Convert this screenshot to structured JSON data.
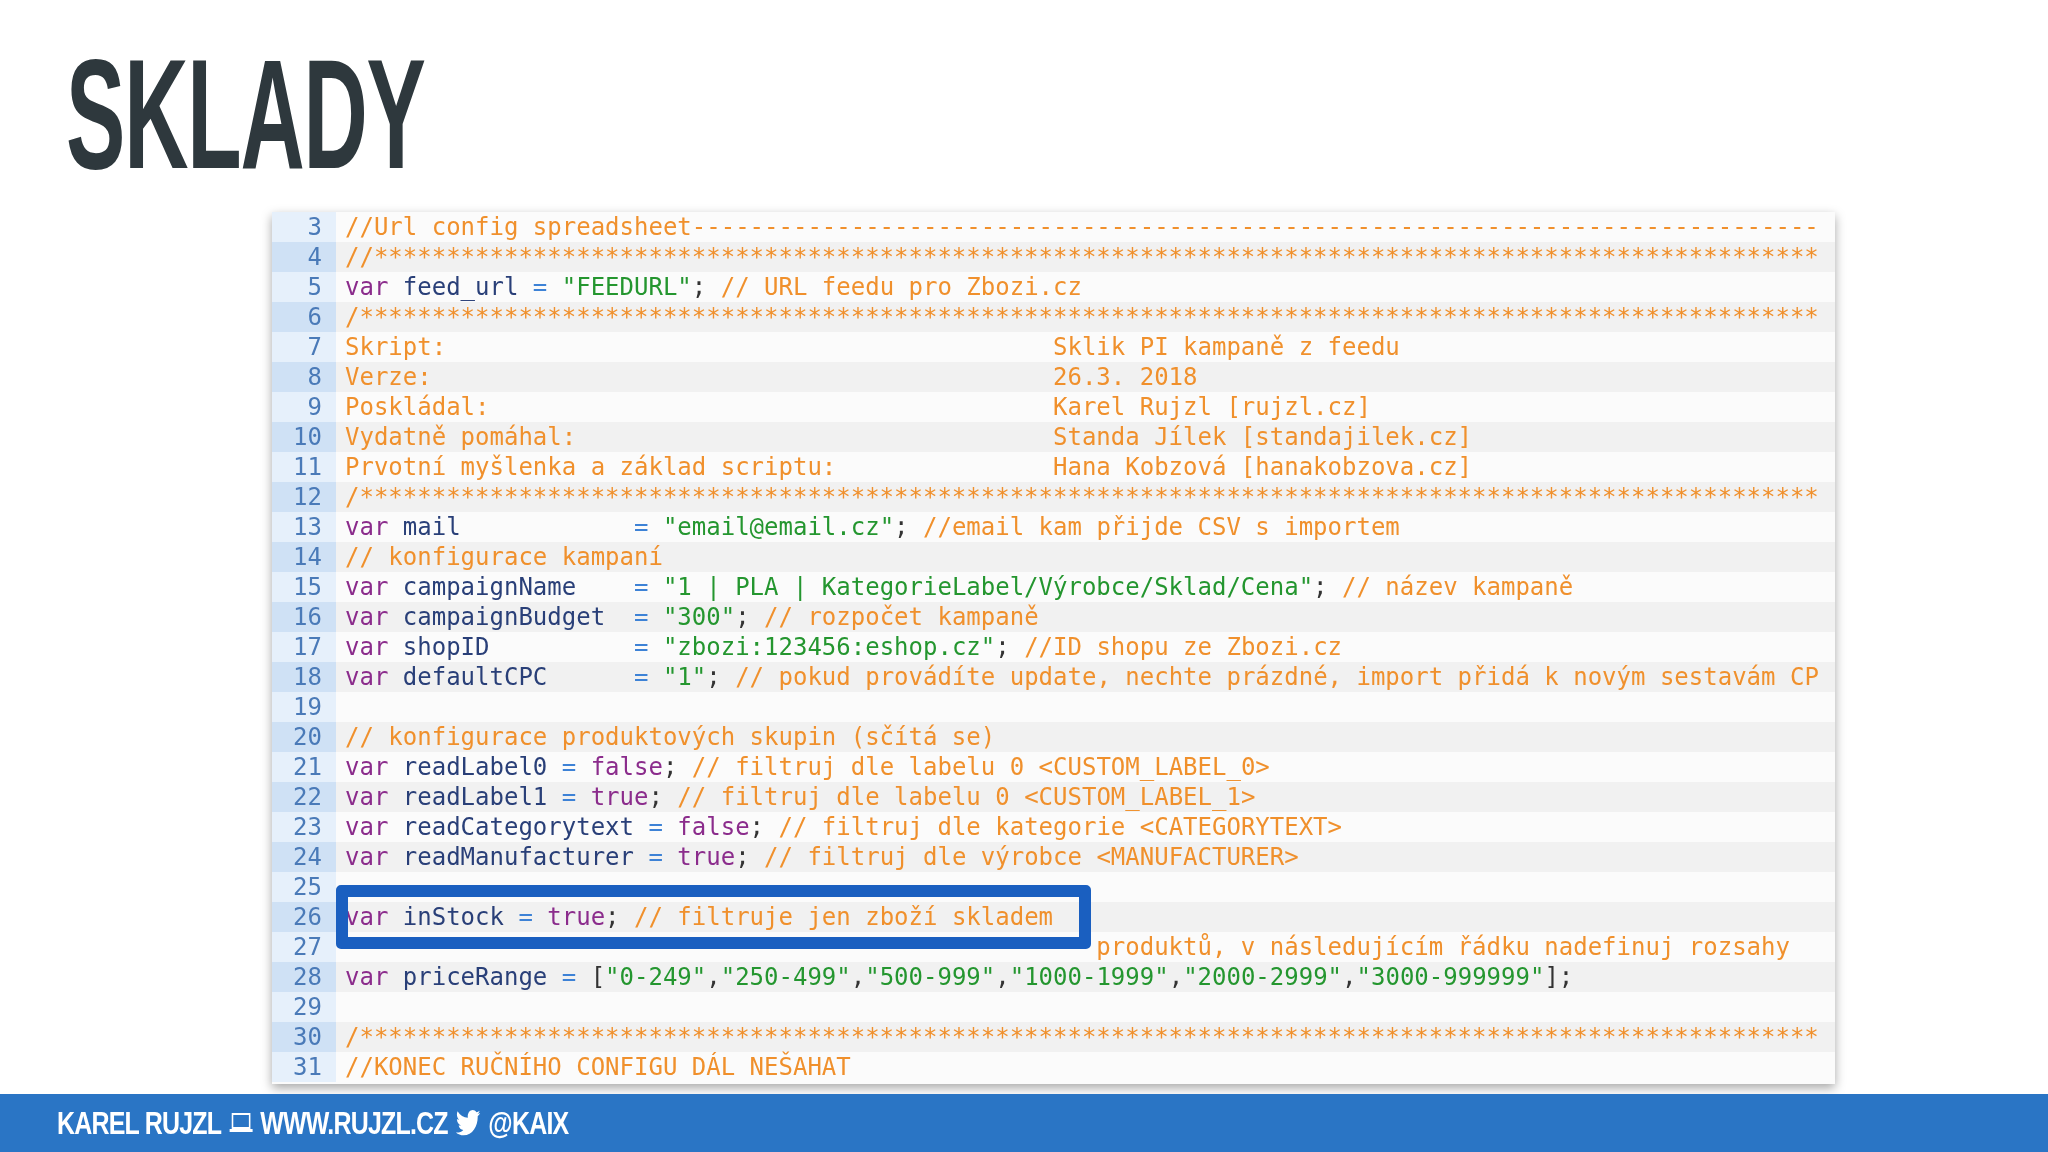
{
  "title": "SKLADY",
  "code": {
    "lines": [
      {
        "number": "3",
        "kind": "code",
        "tokens": [
          {
            "kind": "comment",
            "text": "//Url config spreadsheet------------------------------------------------------------------------------"
          }
        ]
      },
      {
        "number": "4",
        "kind": "code",
        "tokens": [
          {
            "kind": "comment",
            "text": "//****************************************************************************************************"
          }
        ]
      },
      {
        "number": "5",
        "kind": "code",
        "tokens": [
          {
            "kind": "keyword",
            "text": "var "
          },
          {
            "kind": "ident",
            "text": "feed_url "
          },
          {
            "kind": "op",
            "text": "= "
          },
          {
            "kind": "string",
            "text": "\"FEEDURL\""
          },
          {
            "kind": "punct",
            "text": "; "
          },
          {
            "kind": "comment",
            "text": "// URL feedu pro Zbozi.cz"
          }
        ]
      },
      {
        "number": "6",
        "kind": "code",
        "tokens": [
          {
            "kind": "comment",
            "text": "/*****************************************************************************************************"
          }
        ]
      },
      {
        "number": "7",
        "kind": "pair",
        "label": "Skript:",
        "value": "Sklik PI kampaně z feedu"
      },
      {
        "number": "8",
        "kind": "pair",
        "label": "Verze:",
        "value": "26.3. 2018"
      },
      {
        "number": "9",
        "kind": "pair",
        "label": "Poskládal:",
        "value": "Karel Rujzl [rujzl.cz]"
      },
      {
        "number": "10",
        "kind": "pair",
        "label": "Vydatně pomáhal:",
        "value": "Standa Jílek [standajilek.cz]"
      },
      {
        "number": "11",
        "kind": "pair",
        "label": "Prvotní myšlenka a základ scriptu:",
        "value": "Hana Kobzová [hanakobzova.cz]"
      },
      {
        "number": "12",
        "kind": "code",
        "tokens": [
          {
            "kind": "comment",
            "text": "/*****************************************************************************************************"
          }
        ]
      },
      {
        "number": "13",
        "kind": "code",
        "tokens": [
          {
            "kind": "keyword",
            "text": "var "
          },
          {
            "kind": "ident",
            "text": "mail            "
          },
          {
            "kind": "op",
            "text": "= "
          },
          {
            "kind": "string",
            "text": "\"email@email.cz\""
          },
          {
            "kind": "punct",
            "text": "; "
          },
          {
            "kind": "comment",
            "text": "//email kam přijde CSV s importem"
          }
        ]
      },
      {
        "number": "14",
        "kind": "code",
        "tokens": [
          {
            "kind": "comment",
            "text": "// konfigurace kampaní"
          }
        ]
      },
      {
        "number": "15",
        "kind": "code",
        "tokens": [
          {
            "kind": "keyword",
            "text": "var "
          },
          {
            "kind": "ident",
            "text": "campaignName    "
          },
          {
            "kind": "op",
            "text": "= "
          },
          {
            "kind": "string",
            "text": "\"1 | PLA | KategorieLabel/Výrobce/Sklad/Cena\""
          },
          {
            "kind": "punct",
            "text": "; "
          },
          {
            "kind": "comment",
            "text": "// název kampaně"
          }
        ]
      },
      {
        "number": "16",
        "kind": "code",
        "tokens": [
          {
            "kind": "keyword",
            "text": "var "
          },
          {
            "kind": "ident",
            "text": "campaignBudget  "
          },
          {
            "kind": "op",
            "text": "= "
          },
          {
            "kind": "string",
            "text": "\"300\""
          },
          {
            "kind": "punct",
            "text": "; "
          },
          {
            "kind": "comment",
            "text": "// rozpočet kampaně"
          }
        ]
      },
      {
        "number": "17",
        "kind": "code",
        "tokens": [
          {
            "kind": "keyword",
            "text": "var "
          },
          {
            "kind": "ident",
            "text": "shopID          "
          },
          {
            "kind": "op",
            "text": "= "
          },
          {
            "kind": "string",
            "text": "\"zbozi:123456:eshop.cz\""
          },
          {
            "kind": "punct",
            "text": "; "
          },
          {
            "kind": "comment",
            "text": "//ID shopu ze Zbozi.cz"
          }
        ]
      },
      {
        "number": "18",
        "kind": "code",
        "tokens": [
          {
            "kind": "keyword",
            "text": "var "
          },
          {
            "kind": "ident",
            "text": "defaultCPC      "
          },
          {
            "kind": "op",
            "text": "= "
          },
          {
            "kind": "string",
            "text": "\"1\""
          },
          {
            "kind": "punct",
            "text": "; "
          },
          {
            "kind": "comment",
            "text": "// pokud provádíte update, nechte prázdné, import přidá k novým sestavám CP"
          }
        ]
      },
      {
        "number": "19",
        "kind": "code"
      },
      {
        "number": "20",
        "kind": "code",
        "tokens": [
          {
            "kind": "comment",
            "text": "// konfigurace produktových skupin (sčítá se)"
          }
        ]
      },
      {
        "number": "21",
        "kind": "code",
        "tokens": [
          {
            "kind": "keyword",
            "text": "var "
          },
          {
            "kind": "ident",
            "text": "readLabel0 "
          },
          {
            "kind": "op",
            "text": "= "
          },
          {
            "kind": "keyword",
            "text": "false"
          },
          {
            "kind": "punct",
            "text": "; "
          },
          {
            "kind": "comment",
            "text": "// filtruj dle labelu 0 <CUSTOM_LABEL_0>"
          }
        ]
      },
      {
        "number": "22",
        "kind": "code",
        "tokens": [
          {
            "kind": "keyword",
            "text": "var "
          },
          {
            "kind": "ident",
            "text": "readLabel1 "
          },
          {
            "kind": "op",
            "text": "= "
          },
          {
            "kind": "keyword",
            "text": "true"
          },
          {
            "kind": "punct",
            "text": "; "
          },
          {
            "kind": "comment",
            "text": "// filtruj dle labelu 0 <CUSTOM_LABEL_1>"
          }
        ]
      },
      {
        "number": "23",
        "kind": "code",
        "tokens": [
          {
            "kind": "keyword",
            "text": "var "
          },
          {
            "kind": "ident",
            "text": "readCategorytext "
          },
          {
            "kind": "op",
            "text": "= "
          },
          {
            "kind": "keyword",
            "text": "false"
          },
          {
            "kind": "punct",
            "text": "; "
          },
          {
            "kind": "comment",
            "text": "// filtruj dle kategorie <CATEGORYTEXT>"
          }
        ]
      },
      {
        "number": "24",
        "kind": "code",
        "tokens": [
          {
            "kind": "keyword",
            "text": "var "
          },
          {
            "kind": "ident",
            "text": "readManufacturer "
          },
          {
            "kind": "op",
            "text": "= "
          },
          {
            "kind": "keyword",
            "text": "true"
          },
          {
            "kind": "punct",
            "text": "; "
          },
          {
            "kind": "comment",
            "text": "// filtruj dle výrobce <MANUFACTURER>"
          }
        ]
      },
      {
        "number": "25",
        "kind": "covered"
      },
      {
        "number": "26",
        "kind": "code",
        "highlighted": true,
        "tokens": [
          {
            "kind": "keyword",
            "text": "var "
          },
          {
            "kind": "ident",
            "text": "inStock "
          },
          {
            "kind": "op",
            "text": "= "
          },
          {
            "kind": "keyword",
            "text": "true"
          },
          {
            "kind": "punct",
            "text": "; "
          },
          {
            "kind": "comment",
            "text": "// filtruje jen zboží skladem"
          }
        ]
      },
      {
        "number": "27",
        "kind": "covered",
        "tokens": [
          {
            "kind": "comment",
            "text": "produktů, v následujícím řádku nadefinuj rozsahy"
          }
        ]
      },
      {
        "number": "28",
        "kind": "code",
        "tokens": [
          {
            "kind": "keyword",
            "text": "var "
          },
          {
            "kind": "ident",
            "text": "priceRange "
          },
          {
            "kind": "op",
            "text": "= "
          },
          {
            "kind": "punct",
            "text": "["
          },
          {
            "kind": "string",
            "text": "\"0-249\""
          },
          {
            "kind": "punct",
            "text": ","
          },
          {
            "kind": "string",
            "text": "\"250-499\""
          },
          {
            "kind": "punct",
            "text": ","
          },
          {
            "kind": "string",
            "text": "\"500-999\""
          },
          {
            "kind": "punct",
            "text": ","
          },
          {
            "kind": "string",
            "text": "\"1000-1999\""
          },
          {
            "kind": "punct",
            "text": ","
          },
          {
            "kind": "string",
            "text": "\"2000-2999\""
          },
          {
            "kind": "punct",
            "text": ","
          },
          {
            "kind": "string",
            "text": "\"3000-999999\""
          },
          {
            "kind": "punct",
            "text": "];"
          }
        ]
      },
      {
        "number": "29",
        "kind": "code"
      },
      {
        "number": "30",
        "kind": "code",
        "tokens": [
          {
            "kind": "comment",
            "text": "/*****************************************************************************************************"
          }
        ]
      },
      {
        "number": "31",
        "kind": "code",
        "tokens": [
          {
            "kind": "comment",
            "text": "//KONEC RUČNÍHO CONFIGU DÁL NEŠAHAT"
          }
        ]
      }
    ]
  },
  "footer": {
    "author": "KAREL RUJZL",
    "website": "WWW.RUJZL.CZ",
    "handle": "@KAIX"
  }
}
